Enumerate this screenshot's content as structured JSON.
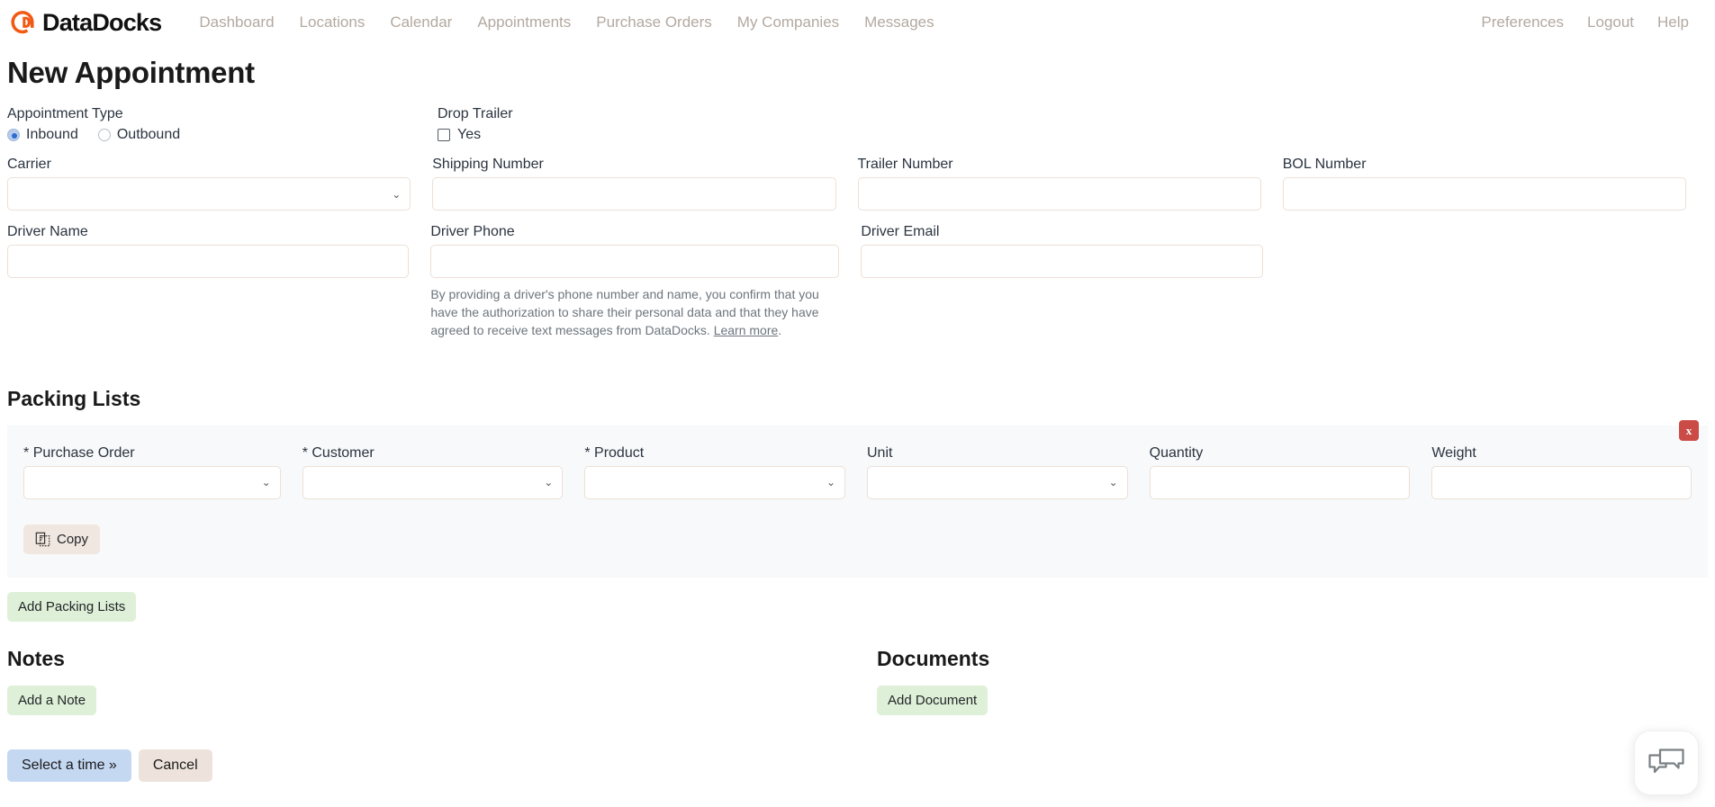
{
  "navbar": {
    "brand": {
      "name": "DataDocks",
      "logo_icon": "datadocks-logo-icon",
      "accent_color": "#f05a14"
    },
    "links": [
      "Dashboard",
      "Locations",
      "Calendar",
      "Appointments",
      "Purchase Orders",
      "My Companies",
      "Messages"
    ],
    "right_links": [
      "Preferences",
      "Logout",
      "Help"
    ]
  },
  "page": {
    "title": "New Appointment"
  },
  "appointment_type": {
    "label": "Appointment Type",
    "options": [
      {
        "label": "Inbound",
        "selected": true
      },
      {
        "label": "Outbound",
        "selected": false
      }
    ]
  },
  "drop_trailer": {
    "label": "Drop Trailer",
    "checkbox_label": "Yes",
    "checked": false
  },
  "fields": {
    "carrier": {
      "label": "Carrier",
      "value": "",
      "type": "select"
    },
    "shipping_number": {
      "label": "Shipping Number",
      "value": "",
      "type": "text"
    },
    "trailer_number": {
      "label": "Trailer Number",
      "value": "",
      "type": "text"
    },
    "bol_number": {
      "label": "BOL Number",
      "value": "",
      "type": "text"
    },
    "driver_name": {
      "label": "Driver Name",
      "value": "",
      "type": "text"
    },
    "driver_phone": {
      "label": "Driver Phone",
      "value": "",
      "type": "text"
    },
    "driver_email": {
      "label": "Driver Email",
      "value": "",
      "type": "text"
    }
  },
  "disclaimer": {
    "text": "By providing a driver's phone number and name, you confirm that you have the authorization to share their personal data and that they have agreed to receive text messages from DataDocks. ",
    "link_text": "Learn more",
    "suffix": "."
  },
  "packing_lists": {
    "title": "Packing Lists",
    "remove_label": "x",
    "copy_label": "Copy",
    "copy_icon": "copy-icon",
    "add_label": "Add Packing Lists",
    "columns": [
      {
        "label": "Purchase Order",
        "required": true,
        "type": "select",
        "value": ""
      },
      {
        "label": "Customer",
        "required": true,
        "type": "select",
        "value": ""
      },
      {
        "label": "Product",
        "required": true,
        "type": "select",
        "value": ""
      },
      {
        "label": "Unit",
        "required": false,
        "type": "select",
        "value": ""
      },
      {
        "label": "Quantity",
        "required": false,
        "type": "text",
        "value": ""
      },
      {
        "label": "Weight",
        "required": false,
        "type": "text",
        "value": ""
      }
    ]
  },
  "notes": {
    "title": "Notes",
    "add_label": "Add a Note"
  },
  "documents": {
    "title": "Documents",
    "add_label": "Add Document"
  },
  "actions": {
    "submit_label": "Select a time »",
    "cancel_label": "Cancel"
  },
  "chat": {
    "icon": "chat-bubbles-icon"
  }
}
